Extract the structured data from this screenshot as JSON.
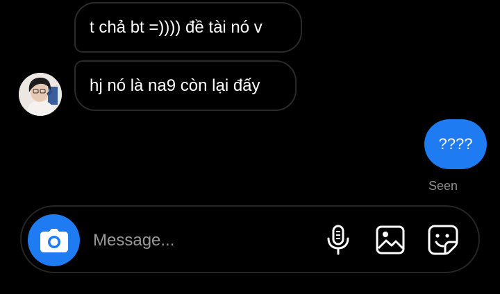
{
  "messages": {
    "received": [
      {
        "text": "t chả bt =)))) đề tài nó v"
      },
      {
        "text": "hj nó là na9 còn lại đấy"
      }
    ],
    "sent": [
      {
        "text": "????"
      }
    ],
    "seen_label": "Seen"
  },
  "composer": {
    "placeholder": "Message..."
  },
  "icons": {
    "camera": "camera-icon",
    "mic": "microphone-icon",
    "gallery": "image-icon",
    "sticker": "sticker-icon"
  },
  "colors": {
    "accent": "#1f7bf2",
    "background": "#000000",
    "bubble_border": "#2a2a2a",
    "text": "#ffffff",
    "muted": "#8e8e8e"
  }
}
